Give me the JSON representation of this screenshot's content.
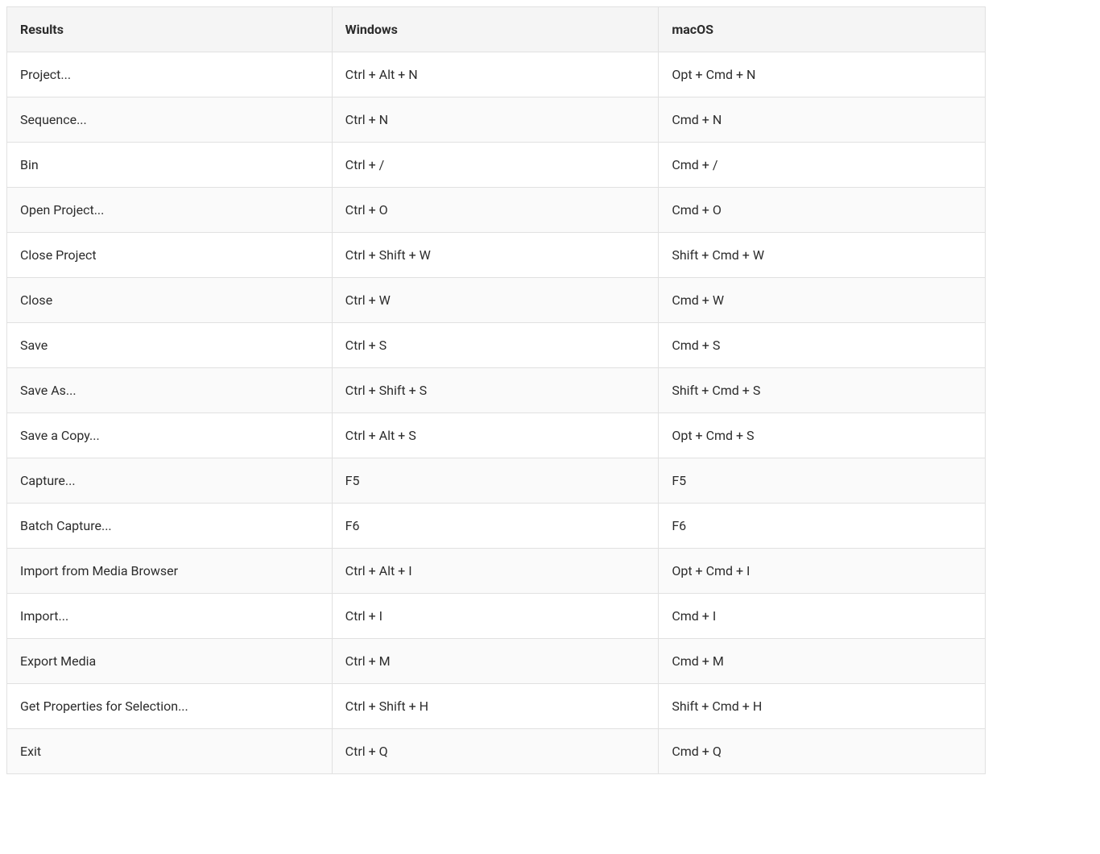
{
  "table": {
    "headers": {
      "results": "Results",
      "windows": "Windows",
      "macos": "macOS"
    },
    "rows": [
      {
        "results": "Project...",
        "windows": "Ctrl + Alt + N",
        "macos": "Opt + Cmd + N"
      },
      {
        "results": "Sequence...",
        "windows": "Ctrl + N",
        "macos": "Cmd + N"
      },
      {
        "results": "Bin",
        "windows": "Ctrl + /",
        "macos": "Cmd + /"
      },
      {
        "results": "Open Project...",
        "windows": "Ctrl + O",
        "macos": "Cmd + O"
      },
      {
        "results": "Close Project",
        "windows": "Ctrl + Shift + W",
        "macos": "Shift + Cmd + W"
      },
      {
        "results": "Close",
        "windows": "Ctrl + W",
        "macos": "Cmd + W"
      },
      {
        "results": "Save",
        "windows": "Ctrl + S",
        "macos": "Cmd + S"
      },
      {
        "results": "Save As...",
        "windows": "Ctrl + Shift + S",
        "macos": "Shift + Cmd + S"
      },
      {
        "results": "Save a Copy...",
        "windows": "Ctrl + Alt + S",
        "macos": "Opt + Cmd + S"
      },
      {
        "results": "Capture...",
        "windows": "F5",
        "macos": "F5"
      },
      {
        "results": "Batch Capture...",
        "windows": "F6",
        "macos": "F6"
      },
      {
        "results": "Import from Media Browser",
        "windows": "Ctrl + Alt + I",
        "macos": "Opt + Cmd + I"
      },
      {
        "results": "Import...",
        "windows": "Ctrl + I",
        "macos": "Cmd + I"
      },
      {
        "results": "Export Media",
        "windows": "Ctrl + M",
        "macos": "Cmd + M"
      },
      {
        "results": "Get Properties for Selection...",
        "windows": "Ctrl + Shift + H",
        "macos": "Shift + Cmd + H"
      },
      {
        "results": "Exit",
        "windows": "Ctrl + Q",
        "macos": "Cmd + Q"
      }
    ]
  }
}
